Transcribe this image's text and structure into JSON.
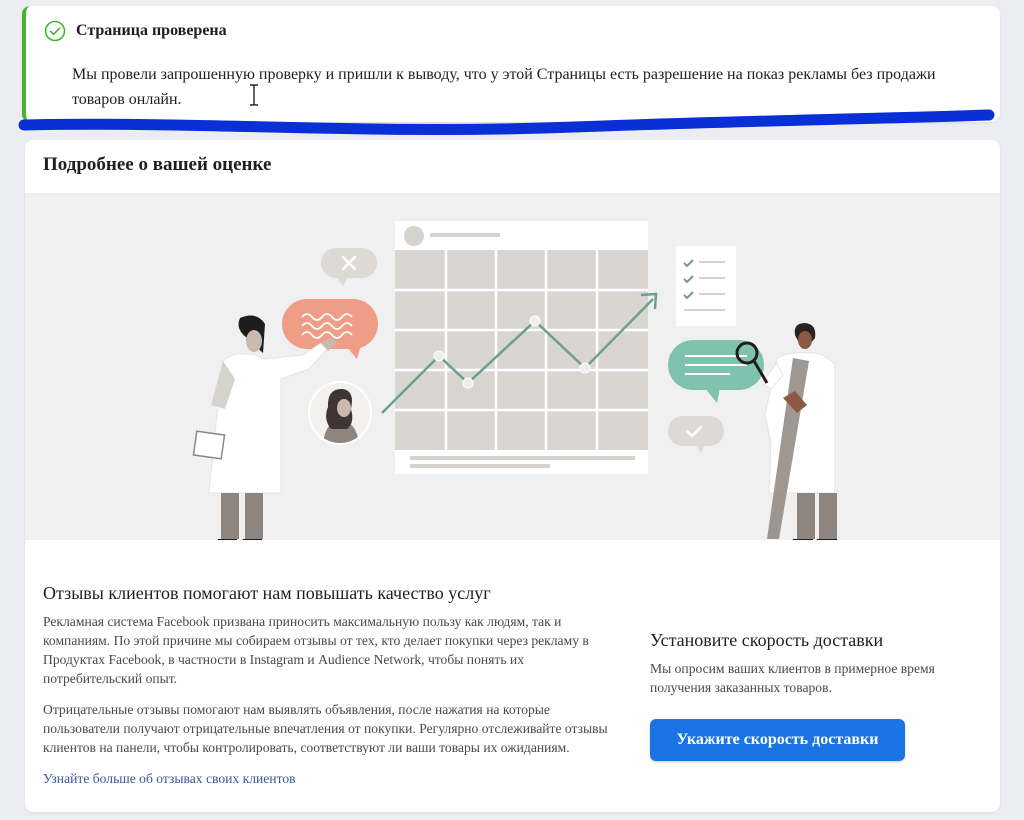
{
  "notice": {
    "title": "Страница проверена",
    "body": "Мы провели запрошенную проверку и пришли к выводу, что у этой Страницы есть разрешение на показ рекламы без продажи товаров онлайн.",
    "accent_color": "#42b72a"
  },
  "assessment": {
    "title": "Подробнее о вашей оценке"
  },
  "reviews": {
    "heading": "Отзывы клиентов помогают нам повышать качество услуг",
    "para1": "Рекламная система Facebook призвана приносить максимальную пользу как людям, так и компаниям. По этой причине мы собираем отзывы от тех, кто делает покупки через рекламу в Продуктах Facebook, в частности в Instagram и Audience Network, чтобы понять их потребительский опыт.",
    "para2": "Отрицательные отзывы помогают нам выявлять объявления, после нажатия на которые пользователи получают отрицательные впечатления от покупки. Регулярно отслеживайте отзывы клиентов на панели, чтобы контролировать, соответствуют ли ваши товары их ожиданиям.",
    "link": "Узнайте больше об отзывах своих клиентов"
  },
  "delivery": {
    "heading": "Установите скорость доставки",
    "text": "Мы опросим ваших клиентов в примерное время получения заказанных товаров.",
    "button": "Укажите скорость доставки",
    "button_color": "#1b74e4"
  },
  "icons": [
    "check-circle-icon",
    "text-cursor-icon"
  ]
}
